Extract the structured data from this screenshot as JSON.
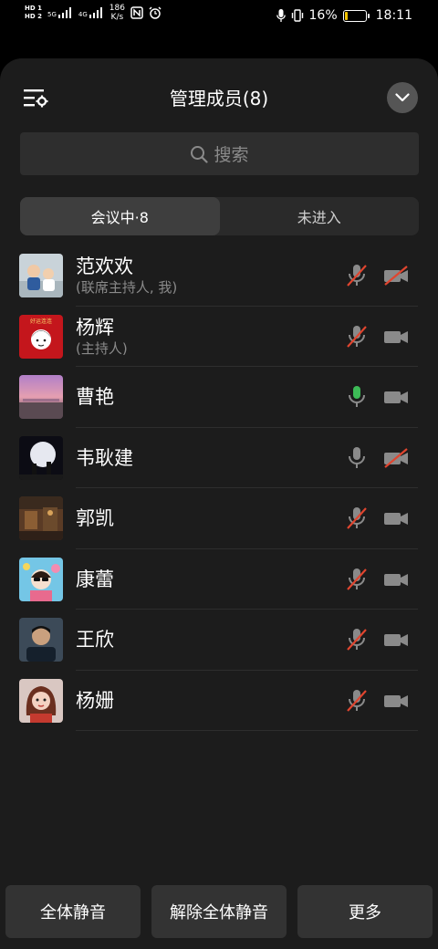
{
  "status_bar": {
    "sim1": "HD 1",
    "sim2": "HD 2",
    "network": "5G",
    "network2": "4G",
    "speed_value": "186",
    "speed_unit": "K/s",
    "battery_percent": "16%",
    "time": "18:11",
    "battery_level": 0.16
  },
  "header": {
    "title": "管理成员(8)"
  },
  "search": {
    "placeholder": "搜索"
  },
  "tabs": [
    {
      "label": "会议中·8",
      "active": true
    },
    {
      "label": "未进入",
      "active": false
    }
  ],
  "members": [
    {
      "name": "范欢欢",
      "role": "(联席主持人, 我)",
      "mic": "muted",
      "camera": "off"
    },
    {
      "name": "杨辉",
      "role": "(主持人)",
      "mic": "muted",
      "camera": "on"
    },
    {
      "name": "曹艳",
      "role": "",
      "mic": "active",
      "camera": "on"
    },
    {
      "name": "韦耿建",
      "role": "",
      "mic": "on",
      "camera": "off"
    },
    {
      "name": "郭凯",
      "role": "",
      "mic": "muted",
      "camera": "on"
    },
    {
      "name": "康蕾",
      "role": "",
      "mic": "muted",
      "camera": "on"
    },
    {
      "name": "王欣",
      "role": "",
      "mic": "muted",
      "camera": "on"
    },
    {
      "name": "杨姗",
      "role": "",
      "mic": "muted",
      "camera": "on"
    }
  ],
  "avatar2_text": "好运连连",
  "actions": {
    "mute_all": "全体静音",
    "unmute_all": "解除全体静音",
    "more": "更多"
  },
  "colors": {
    "mute_slash": "#e0452f",
    "mic_active": "#3dbb57",
    "icon_gray": "#8a8a8a"
  }
}
